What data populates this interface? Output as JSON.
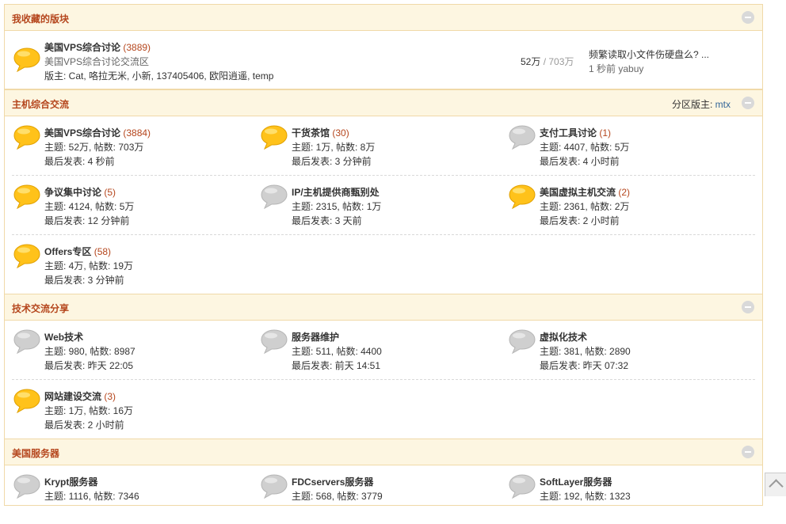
{
  "colors": {
    "accent": "#b5461d",
    "header_bg": "#fdf6e1",
    "border": "#f0d9a8",
    "new_icon": "#ffcc33",
    "old_icon": "#cfcfcf"
  },
  "favorites": {
    "title": "我收藏的版块",
    "forum": {
      "name": "美国VPS综合讨论",
      "count": "(3889)",
      "desc": "美国VPS综合讨论交流区",
      "mods": "版主: Cat, 咯拉无米, 小新, 137405406, 欧阳逍遥, temp",
      "threads": "52万",
      "sep": " / ",
      "posts": "703万",
      "last_title": "频繁读取小文件伤硬盘么?  ...",
      "last_meta": "1 秒前 yabuy",
      "icon": "speech-bubble-new-icon"
    }
  },
  "sections": [
    {
      "title": "主机综合交流",
      "mod_label": "分区版主: ",
      "mod_name": "mtx",
      "rows": [
        [
          {
            "name": "美国VPS综合讨论",
            "count": "(3884)",
            "stats": "主题: 52万, 帖数: 703万",
            "last": "最后发表: 4 秒前",
            "new": true
          },
          {
            "name": "干货茶馆",
            "count": "(30)",
            "stats": "主题: 1万, 帖数: 8万",
            "last": "最后发表: 3 分钟前",
            "new": true
          },
          {
            "name": "支付工具讨论",
            "count": "(1)",
            "stats": "主题: 4407, 帖数: 5万",
            "last": "最后发表: 4 小时前",
            "new": false
          }
        ],
        [
          {
            "name": "争议集中讨论",
            "count": "(5)",
            "stats": "主题: 4124, 帖数: 5万",
            "last": "最后发表: 12 分钟前",
            "new": true
          },
          {
            "name": "IP/主机提供商甄别处",
            "count": "",
            "stats": "主题: 2315, 帖数: 1万",
            "last": "最后发表: 3 天前",
            "new": false
          },
          {
            "name": "美国虚拟主机交流",
            "count": "(2)",
            "stats": "主题: 2361, 帖数: 2万",
            "last": "最后发表: 2 小时前",
            "new": true
          }
        ],
        [
          {
            "name": "Offers专区",
            "count": "(58)",
            "stats": "主题: 4万, 帖数: 19万",
            "last": "最后发表: 3 分钟前",
            "new": true
          }
        ]
      ]
    },
    {
      "title": "技术交流分享",
      "rows": [
        [
          {
            "name": "Web技术",
            "count": "",
            "stats": "主题: 980, 帖数: 8987",
            "last": "最后发表: 昨天 22:05",
            "new": false
          },
          {
            "name": "服务器维护",
            "count": "",
            "stats": "主题: 511, 帖数: 4400",
            "last": "最后发表: 前天 14:51",
            "new": false
          },
          {
            "name": "虚拟化技术",
            "count": "",
            "stats": "主题: 381, 帖数: 2890",
            "last": "最后发表: 昨天 07:32",
            "new": false
          }
        ],
        [
          {
            "name": "网站建设交流",
            "count": "(3)",
            "stats": "主题: 1万, 帖数: 16万",
            "last": "最后发表: 2 小时前",
            "new": true
          }
        ]
      ]
    },
    {
      "title": "美国服务器",
      "rows": [
        [
          {
            "name": "Krypt服务器",
            "count": "",
            "stats": "主题: 1116, 帖数: 7346",
            "last": "",
            "new": false
          },
          {
            "name": "FDCservers服务器",
            "count": "",
            "stats": "主题: 568, 帖数: 3779",
            "last": "",
            "new": false
          },
          {
            "name": "SoftLayer服务器",
            "count": "",
            "stats": "主题: 192, 帖数: 1323",
            "last": "",
            "new": false
          }
        ]
      ]
    }
  ]
}
